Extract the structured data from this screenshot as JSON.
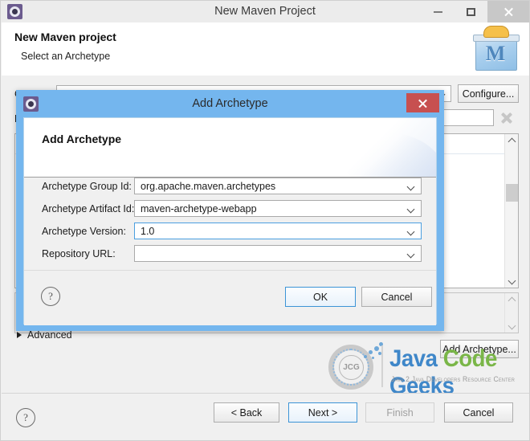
{
  "window": {
    "title": "New Maven Project",
    "icon": "maven-app-icon",
    "minimize_label": "–",
    "maximize_label": "□",
    "close_label": "✕"
  },
  "wizard_header": {
    "title": "New Maven project",
    "subtitle": "Select an Archetype",
    "logo_letter": "M"
  },
  "wizard_body": {
    "catalog_label": "C",
    "filter_label": "F",
    "configure_button": "Configure...",
    "add_archetype_button": "Add Archetype...",
    "advanced_label": "Advanced"
  },
  "dialog": {
    "titlebar_title": "Add Archetype",
    "close_label": "✕",
    "heading": "Add Archetype",
    "fields": [
      {
        "label": "Archetype Group Id:",
        "value": "org.apache.maven.archetypes",
        "focused": false
      },
      {
        "label": "Archetype Artifact Id:",
        "value": "maven-archetype-webapp",
        "focused": false
      },
      {
        "label": "Archetype Version:",
        "value": "1.0",
        "focused": true
      },
      {
        "label": "Repository URL:",
        "value": "",
        "focused": false
      }
    ],
    "help_label": "?",
    "ok_button": "OK",
    "cancel_button": "Cancel"
  },
  "wizard_footer": {
    "help_label": "?",
    "back_button": "< Back",
    "next_button": "Next >",
    "finish_button": "Finish",
    "cancel_button": "Cancel"
  },
  "watermark": {
    "word1": "Java",
    "word2": "Code",
    "word3": "Geeks",
    "tagline": "Java 2 Java Developers Resource Center",
    "monogram": "JCG",
    "color_blue": "#3f87c9",
    "color_green": "#7ab648"
  },
  "colors": {
    "dialog_frame": "#74b6ee",
    "close_red": "#c75050",
    "focus_blue": "#4b9fe0",
    "window_chrome": "#ececec"
  }
}
